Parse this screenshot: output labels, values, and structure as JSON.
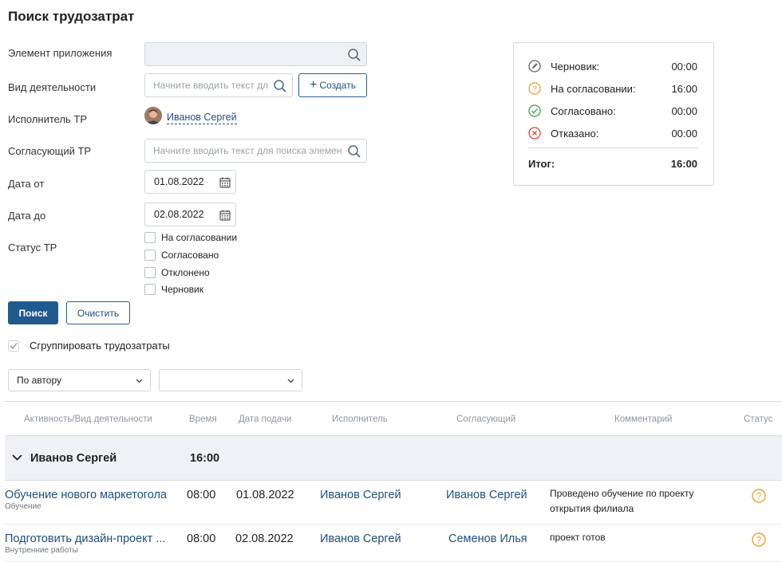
{
  "page": {
    "title": "Поиск трудозатрат"
  },
  "form": {
    "app_element": {
      "label": "Элемент приложения",
      "value": "",
      "placeholder": ""
    },
    "activity_type": {
      "label": "Вид деятельности",
      "placeholder": "Начните вводить текст дл",
      "create_label": "Создать"
    },
    "executor": {
      "label": "Исполнитель ТР",
      "user": "Иванов Сергей"
    },
    "approver": {
      "label": "Согласующий ТР",
      "placeholder": "Начните вводить текст для поиска элемент"
    },
    "date_from": {
      "label": "Дата от",
      "value": "01.08.2022"
    },
    "date_to": {
      "label": "Дата до",
      "value": "02.08.2022"
    },
    "status": {
      "label": "Статус ТР",
      "options": [
        "На согласовании",
        "Согласовано",
        "Отклонено",
        "Черновик"
      ]
    },
    "search_label": "Поиск",
    "clear_label": "Очистить",
    "group_label": "Сгруппировать трудозатраты",
    "group_checked": true,
    "group_by": {
      "value": "По автору"
    },
    "group_by2": {
      "value": ""
    }
  },
  "summary": {
    "rows": [
      {
        "label": "Черновик:",
        "value": "00:00",
        "icon": "draft-icon"
      },
      {
        "label": "На согласовании:",
        "value": "16:00",
        "icon": "pending-icon"
      },
      {
        "label": "Согласовано:",
        "value": "00:00",
        "icon": "approved-icon"
      },
      {
        "label": "Отказано:",
        "value": "00:00",
        "icon": "rejected-icon"
      }
    ],
    "total_label": "Итог:",
    "total_value": "16:00",
    "colors": {
      "pending": "#f0a030",
      "approved": "#3a9a4a",
      "rejected": "#e04040",
      "draft": "#666666"
    }
  },
  "table": {
    "columns": [
      "Активность/Вид деятельности",
      "Время",
      "Дата подачи",
      "Исполнитель",
      "Согласующий",
      "Комментарий",
      "Статус"
    ],
    "group": {
      "name": "Иванов Сергей",
      "time": "16:00"
    },
    "rows": [
      {
        "activity": "Обучение нового маркетогола",
        "type": "Обучение",
        "time": "08:00",
        "date": "01.08.2022",
        "executor": "Иванов Сергей",
        "approver": "Иванов Сергей",
        "comment_line1": "Проведено обучение по проекту",
        "comment_line2": "открытия филиала",
        "status": "pending"
      },
      {
        "activity": "Подготовить дизайн-проект ...",
        "type": "Внутренние работы",
        "time": "08:00",
        "date": "02.08.2022",
        "executor": "Иванов Сергей",
        "approver": "Семенов Илья",
        "comment_line1": "проект готов",
        "comment_line2": "",
        "status": "pending"
      }
    ]
  }
}
